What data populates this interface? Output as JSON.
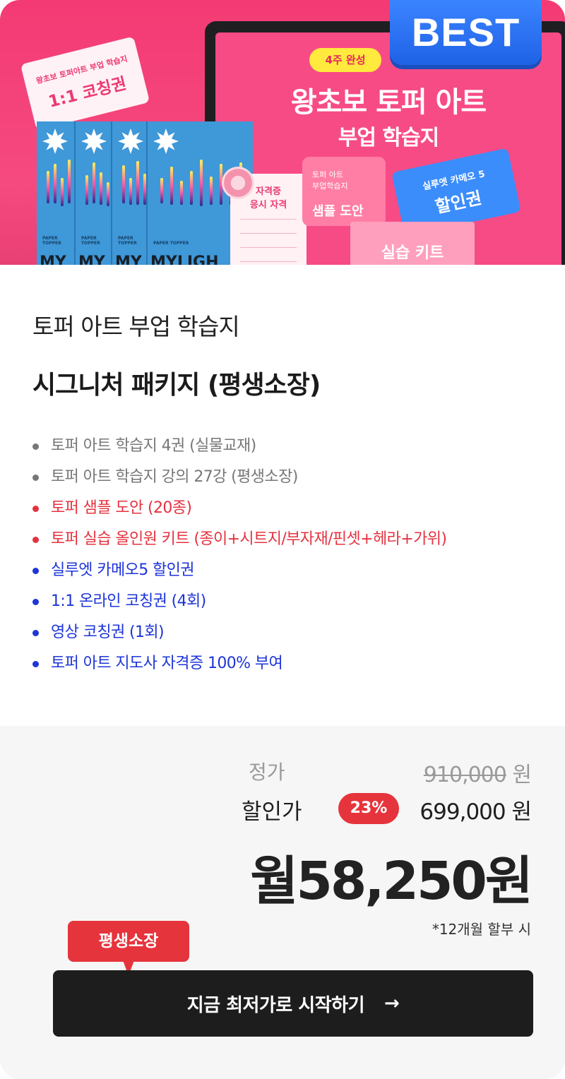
{
  "hero": {
    "best_badge": "BEST",
    "ticket_coaching_small": "왕초보 토퍼아트 부업 학습지",
    "ticket_coaching_big": "1:1 코칭권",
    "tag_4weeks": "4주 완성",
    "screen_title_1": "왕초보 토퍼 아트",
    "screen_title_2": "부업 학습지",
    "cert_line_1": "자격증",
    "cert_line_2": "응시 자격",
    "sample_small_1": "토퍼 아트",
    "sample_small_2": "부업학습지",
    "sample_big": "샘플 도안",
    "discount_small": "실루엣 카메오 5",
    "discount_big": "할인권",
    "kit": "실습 키트",
    "book_spine_label": "PAPER TOPPER",
    "book_bottom_text": [
      "MY",
      "MY",
      "MY",
      "MYLIGH"
    ]
  },
  "product": {
    "subtitle": "토퍼 아트 부업 학습지",
    "title": "시그니처 패키지 (평생소장)"
  },
  "features": [
    {
      "text": "토퍼 아트 학습지 4권 (실물교재)",
      "color": "gray"
    },
    {
      "text": "토퍼 아트 학습지 강의 27강 (평생소장)",
      "color": "gray"
    },
    {
      "text": "토퍼 샘플 도안 (20종)",
      "color": "red"
    },
    {
      "text": "토퍼 실습 올인원 키트 (종이+시트지/부자재/핀셋+헤라+가위)",
      "color": "red"
    },
    {
      "text": "실루엣 카메오5 할인권",
      "color": "blue"
    },
    {
      "text": "1:1 온라인 코칭권 (4회)",
      "color": "blue"
    },
    {
      "text": "영상 코칭권 (1회)",
      "color": "blue"
    },
    {
      "text": "토퍼 아트 지도사 자격증 100% 부여",
      "color": "blue"
    }
  ],
  "price": {
    "list_label": "정가",
    "list_price": "910,000",
    "list_unit": "원",
    "sale_label": "할인가",
    "discount": "23%",
    "sale_price": "699,000 원",
    "monthly": "월58,250원",
    "installment_note": "*12개월 할부 시"
  },
  "cta": {
    "badge": "평생소장",
    "label": "지금 최저가로 시작하기",
    "arrow": "→"
  },
  "colors": {
    "hero_pink": "#f43a74",
    "best_blue": "#1e62e6",
    "accent_red": "#e6343c",
    "feature_gray": "#777777",
    "feature_red": "#e5323f",
    "feature_blue": "#1d35d8",
    "cta_bg": "#1d1d1d"
  }
}
